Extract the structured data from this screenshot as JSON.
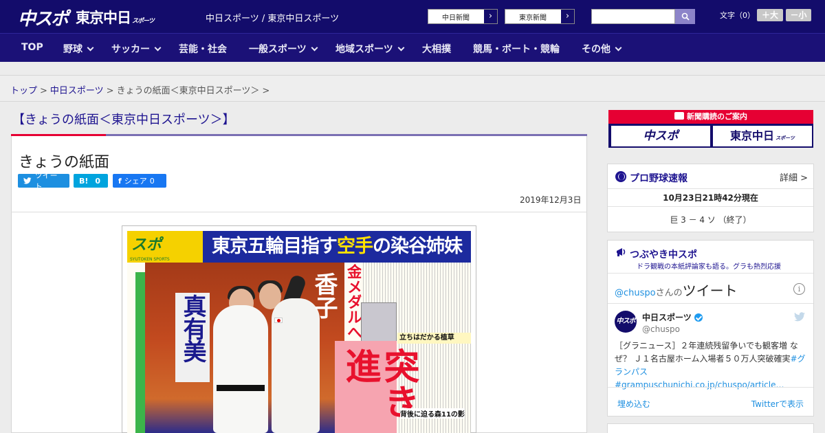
{
  "header": {
    "logo_chuspo": "中スポ",
    "logo_tokyo": "東京中日",
    "logo_tokyo_small": "スポーツ",
    "site_tag": "中日スポーツ / 東京中日スポーツ",
    "ext_links": [
      {
        "label": "中日新聞",
        "arrow": "›"
      },
      {
        "label": "東京新聞",
        "arrow": "›"
      }
    ],
    "search": {
      "value": "",
      "placeholder": ""
    },
    "font_size_label": "文字（0）",
    "font_bigger": "＋大",
    "font_smaller": "－小"
  },
  "nav": {
    "items": [
      {
        "label": "TOP"
      },
      {
        "label": "野球"
      },
      {
        "label": "サッカー"
      },
      {
        "label": "芸能・社会"
      },
      {
        "label": "一般スポーツ"
      },
      {
        "label": "地域スポーツ"
      },
      {
        "label": "大相撲"
      },
      {
        "label": "競馬・ボート・競輪"
      },
      {
        "label": "その他"
      }
    ]
  },
  "breadcrumb": {
    "top": "トップ",
    "sep": ">",
    "chunichi": "中日スポーツ",
    "current": "きょうの紙面＜東京中日スポーツ＞",
    "trail": ">"
  },
  "main": {
    "section_title": "【きょうの紙面＜東京中日スポーツ＞】",
    "article_title": "きょうの紙面",
    "share": {
      "tweet": {
        "icon": "🐦",
        "label": "ツイート"
      },
      "hatena": {
        "icon": "B!",
        "count": "0"
      },
      "facebook": {
        "icon": "f",
        "label": "シェア",
        "count": "0"
      }
    },
    "date": "2019年12月3日"
  },
  "newspaper": {
    "logo_main": "スポ",
    "logo_small": "SYUTOKEN SPORTS",
    "headline_a": "東京五輪目指す",
    "headline_b": "空手",
    "headline_c": "の染谷姉妹",
    "name_left": "真有美",
    "name_right": "香子",
    "medal": "金メダルへ",
    "big": "突き進",
    "sub_bar": "立ちはだかる植草",
    "bottom_note": "背後に迫る森11の影"
  },
  "sidebar": {
    "subscribe": {
      "band": "新聞購読のご案内",
      "logo_chuspo": "中スポ",
      "logo_tokyo": "東京中日",
      "logo_tokyo_small": "スポーツ"
    },
    "baseball": {
      "title": "プロ野球速報",
      "detail": "詳細 >",
      "time": "10月23日21時42分現在",
      "score": "巨 3 － 4 ソ （終了）"
    },
    "twitter": {
      "title": "つぶやき中スポ",
      "sub": "ドラ観戦の本紙評論家も語る。グラも熱烈応援",
      "heading_handle": "@chuspo",
      "heading_san": "さんの",
      "heading_word": "ツイート",
      "info": "i",
      "avatar": "中スポ",
      "name": "中日スポーツ",
      "handle": "@chuspo",
      "text_a": "［グラニュース］２年連続残留争いでも観客増 なぜ？ Ｊ１名古屋ホーム入場者５０万人突破確実",
      "text_b": "#グランパス #grampuschunichi.co.jp/chuspo/article…",
      "embed": "埋め込む",
      "view": "Twitterで表示"
    }
  },
  "colors": {
    "header_bg": "#130c6b",
    "nav_bg": "#1b1177",
    "accent_red": "#e60033",
    "link": "#1e1490",
    "twitter_blue": "#1d8fe0"
  }
}
